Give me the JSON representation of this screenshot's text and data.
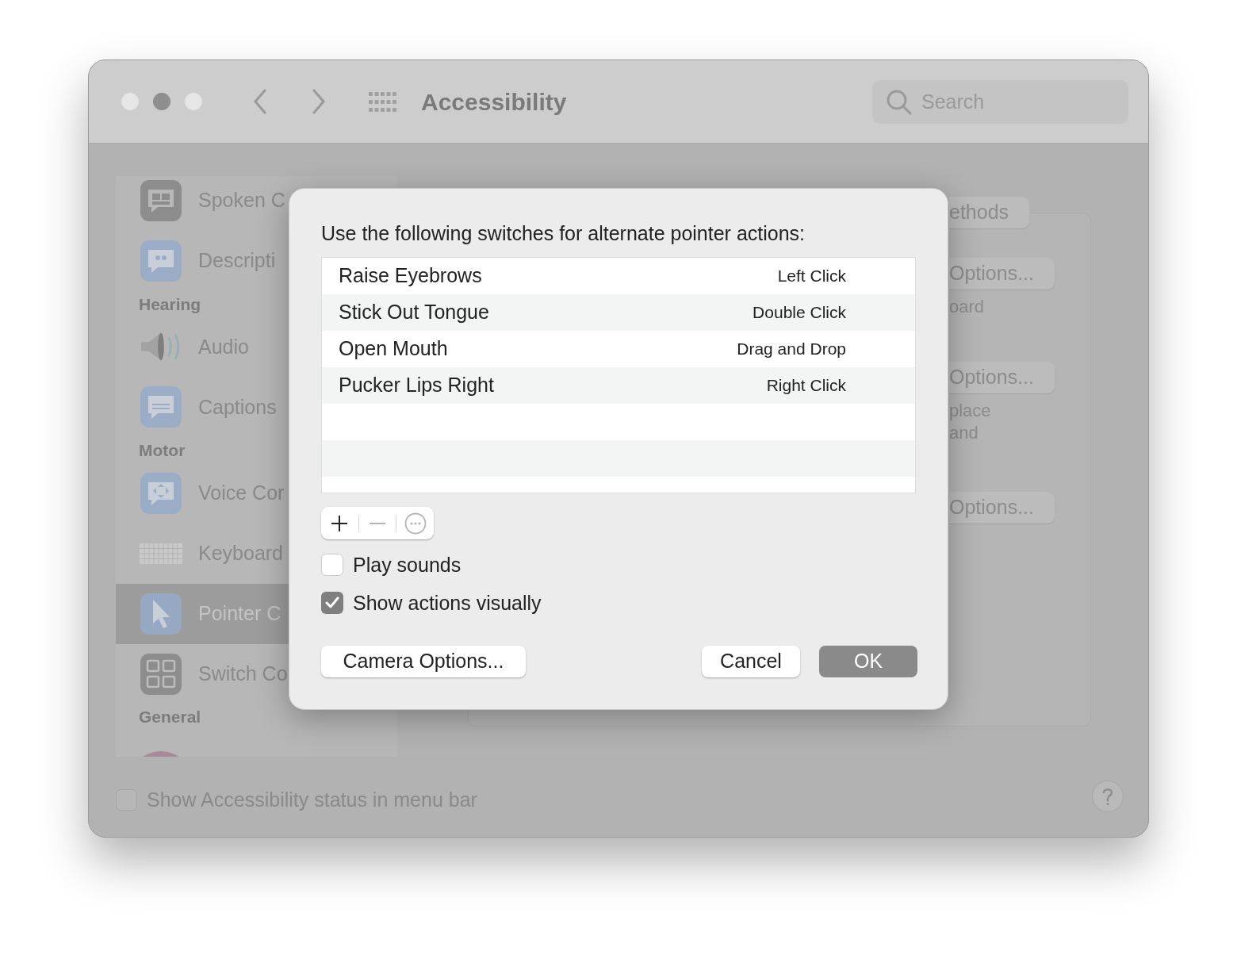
{
  "window": {
    "title": "Accessibility",
    "search": {
      "placeholder": "Search"
    }
  },
  "sidebar": {
    "items": [
      {
        "kind": "item",
        "label": "Spoken C",
        "selected": false
      },
      {
        "kind": "item",
        "label": "Descripti",
        "selected": false
      },
      {
        "kind": "section",
        "label": "Hearing"
      },
      {
        "kind": "item",
        "label": "Audio",
        "selected": false
      },
      {
        "kind": "item",
        "label": "Captions",
        "selected": false
      },
      {
        "kind": "section",
        "label": "Motor"
      },
      {
        "kind": "item",
        "label": "Voice Cor",
        "selected": false
      },
      {
        "kind": "item",
        "label": "Keyboard",
        "selected": false
      },
      {
        "kind": "item",
        "label": "Pointer C",
        "selected": true
      },
      {
        "kind": "item",
        "label": "Switch Co",
        "selected": false
      },
      {
        "kind": "section",
        "label": "General"
      }
    ]
  },
  "background_panel": [
    {
      "kind": "button",
      "label": "ethods"
    },
    {
      "kind": "button",
      "label": "Options..."
    },
    {
      "kind": "text",
      "label": "oard"
    },
    {
      "kind": "button",
      "label": "Options..."
    },
    {
      "kind": "text",
      "label": "place"
    },
    {
      "kind": "text",
      "label": "and"
    },
    {
      "kind": "button",
      "label": "Options..."
    }
  ],
  "status_checkbox": {
    "label": "Show Accessibility status in menu bar",
    "checked": false
  },
  "dialog": {
    "prompt": "Use the following switches for alternate pointer actions:",
    "rows": [
      {
        "switch": "Raise Eyebrows",
        "action": "Left Click"
      },
      {
        "switch": "Stick Out Tongue",
        "action": "Double Click"
      },
      {
        "switch": "Open Mouth",
        "action": "Drag and Drop"
      },
      {
        "switch": "Pucker Lips Right",
        "action": "Right Click"
      }
    ],
    "list_buttons": [
      {
        "kind": "add",
        "disabled": false
      },
      {
        "kind": "remove",
        "disabled": true
      },
      {
        "kind": "more",
        "disabled": true
      }
    ],
    "checkboxes": [
      {
        "label": "Play sounds",
        "checked": false
      },
      {
        "label": "Show actions visually",
        "checked": true
      }
    ],
    "buttons": [
      {
        "label": "Camera Options...",
        "kind": "normal"
      },
      {
        "label": "Cancel",
        "kind": "normal"
      },
      {
        "label": "OK",
        "kind": "default"
      }
    ]
  }
}
